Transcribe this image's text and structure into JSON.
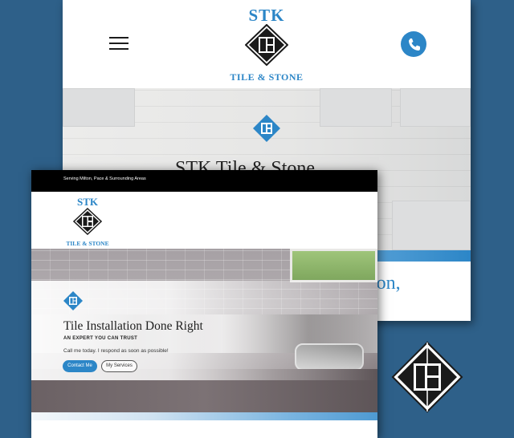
{
  "mobile": {
    "logo": {
      "name": "STK",
      "subtitle": "TILE & STONE"
    },
    "hero_title": "STK Tile & Stone",
    "hero_subtitle_partial": "ton,"
  },
  "desktop": {
    "topbar_text": "Serving Milton, Pace & Surrounding Areas",
    "logo": {
      "name": "STK",
      "subtitle": "TILE & STONE"
    },
    "hero": {
      "title": "Tile Installation Done Right",
      "tagline": "AN EXPERT YOU CAN TRUST",
      "call_text": "Call me today. I respond as soon as possible!",
      "contact_button": "Contact Me",
      "services_button": "My Services"
    }
  },
  "colors": {
    "accent": "#2c86c7",
    "background": "#2e6089",
    "topbar": "#000000"
  },
  "icons": [
    "hamburger-menu-icon",
    "phone-icon",
    "stk-logo-icon",
    "diamond-logo-icon"
  ]
}
